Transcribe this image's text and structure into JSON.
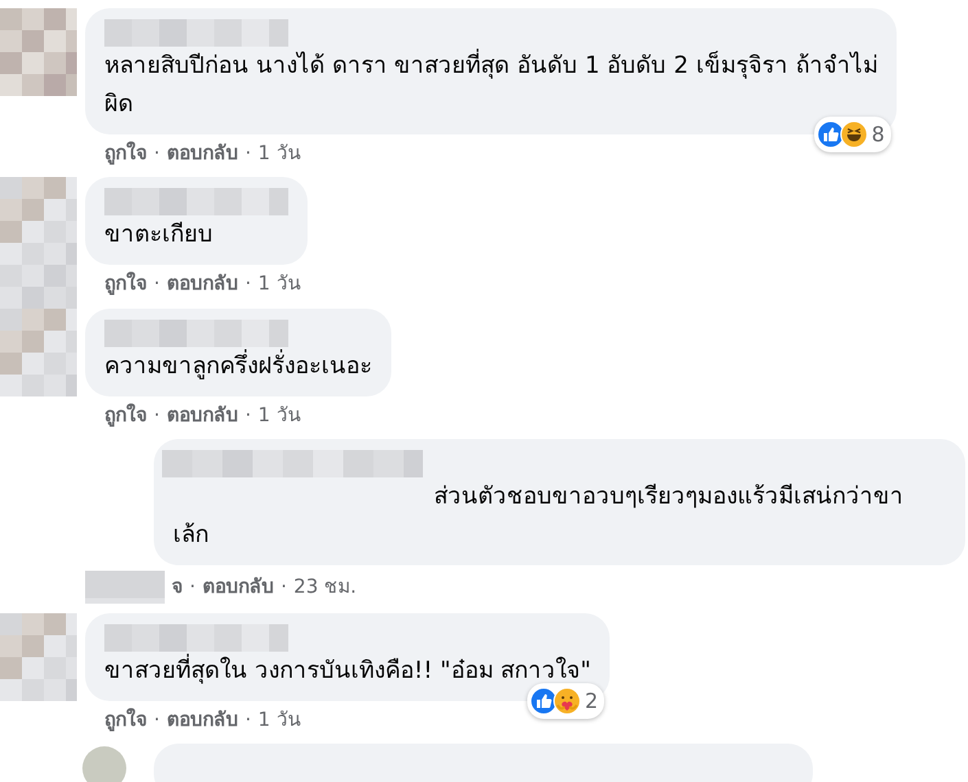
{
  "comments": [
    {
      "kind": "comment",
      "lines": [
        "หลายสิบปีก่อน นางได้ ดารา ขาสวยที่สุด อันดับ 1 อับดับ 2 เข็มรุจิรา ถ้าจำไม่",
        "ผิด"
      ],
      "reactions": [
        {
          "kind": "like"
        },
        {
          "kind": "haha"
        }
      ],
      "reaction_count": "8",
      "actions": [
        {
          "kind": "link",
          "text": "ถูกใจ"
        },
        {
          "kind": "separator",
          "text": "·"
        },
        {
          "kind": "link",
          "text": "ตอบกลับ"
        },
        {
          "kind": "separator",
          "text": "·"
        },
        {
          "kind": "time",
          "text": "1 วัน"
        }
      ]
    },
    {
      "kind": "comment",
      "lines": [
        "ขาตะเกียบ"
      ],
      "actions": [
        {
          "kind": "link",
          "text": "ถูกใจ"
        },
        {
          "kind": "separator",
          "text": "·"
        },
        {
          "kind": "link",
          "text": "ตอบกลับ"
        },
        {
          "kind": "separator",
          "text": "·"
        },
        {
          "kind": "time",
          "text": "1 วัน"
        }
      ]
    },
    {
      "kind": "comment",
      "lines": [
        "ความขาลูกครึ่งฝรั่งอะเนอะ"
      ],
      "actions": [
        {
          "kind": "link",
          "text": "ถูกใจ"
        },
        {
          "kind": "separator",
          "text": "·"
        },
        {
          "kind": "link",
          "text": "ตอบกลับ"
        },
        {
          "kind": "separator",
          "text": "·"
        },
        {
          "kind": "time",
          "text": "1 วัน"
        }
      ]
    },
    {
      "kind": "reply",
      "lines": [
        "ส่วนตัวชอบขาอวบๆเรียวๆมองแร้วมีเสน่กว่าขา",
        "เล้ก"
      ],
      "actions": [
        {
          "kind": "link",
          "text": "จ"
        },
        {
          "kind": "separator",
          "text": "·"
        },
        {
          "kind": "link",
          "text": "ตอบกลับ"
        },
        {
          "kind": "separator",
          "text": "·"
        },
        {
          "kind": "time",
          "text": "23 ชม."
        }
      ]
    },
    {
      "kind": "comment",
      "lines": [
        "ขาสวยที่สุดใน วงการบันเทิงคือ!! \"อ๋อม สกาวใจ\""
      ],
      "reactions": [
        {
          "kind": "like"
        },
        {
          "kind": "care"
        }
      ],
      "reaction_count": "2",
      "actions": [
        {
          "kind": "link",
          "text": "ถูกใจ"
        },
        {
          "kind": "separator",
          "text": "·"
        },
        {
          "kind": "link",
          "text": "ตอบกลับ"
        },
        {
          "kind": "separator",
          "text": "·"
        },
        {
          "kind": "time",
          "text": "1 วัน"
        }
      ]
    }
  ]
}
